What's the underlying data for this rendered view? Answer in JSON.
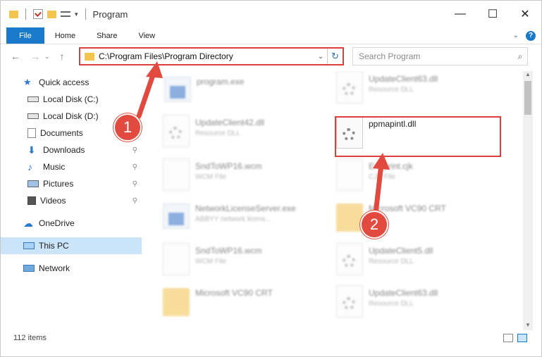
{
  "window": {
    "title": "Program",
    "controls": {
      "minimize": "—",
      "maximize": "☐",
      "close": "✕"
    }
  },
  "ribbon": {
    "tabs": [
      "File",
      "Home",
      "Share",
      "View"
    ],
    "expand_icon": "chevron-down",
    "help_label": "?"
  },
  "address": {
    "path": "C:\\Program Files\\Program Directory",
    "dropdown": "⌄",
    "refresh": "↻"
  },
  "search": {
    "placeholder": "Search Program",
    "icon": "⌕"
  },
  "sidebar": {
    "items": [
      {
        "label": "Quick access",
        "icon": "star-icon"
      },
      {
        "label": "Local Disk (C:)",
        "icon": "drive-icon"
      },
      {
        "label": "Local Disk (D:)",
        "icon": "drive-icon"
      },
      {
        "label": "Documents",
        "icon": "documents-icon"
      },
      {
        "label": "Downloads",
        "icon": "download-icon"
      },
      {
        "label": "Music",
        "icon": "music-icon"
      },
      {
        "label": "Pictures",
        "icon": "pictures-icon"
      },
      {
        "label": "Videos",
        "icon": "videos-icon"
      },
      {
        "label": "OneDrive",
        "icon": "cloud-icon"
      },
      {
        "label": "This PC",
        "icon": "computer-icon"
      },
      {
        "label": "Network",
        "icon": "network-icon"
      }
    ],
    "pin_glyph": "📌"
  },
  "files": [
    {
      "name": "program.exe",
      "type": ""
    },
    {
      "name": "UpdateClient63.dll",
      "type": "Resource DLL"
    },
    {
      "name": "UpdateClient42.dll",
      "type": "Resource DLL"
    },
    {
      "name": "ppmapintl.dll",
      "type": ""
    },
    {
      "name": "SndToWP16.wcm",
      "type": "WCM File"
    },
    {
      "name": "Endprint.cjk",
      "type": "CJK File"
    },
    {
      "name": "NetworkLicenseServer.exe",
      "type": "ABBYY network licens..."
    },
    {
      "name": "Microsoft VC90 CRT",
      "type": ""
    },
    {
      "name": "SndToWP16.wcm",
      "type": "WCM File"
    },
    {
      "name": "UpdateClient5.dll",
      "type": "Resource DLL"
    },
    {
      "name": "Microsoft VC90 CRT",
      "type": ""
    },
    {
      "name": "UpdateClient63.dll",
      "type": "Resource DLL"
    }
  ],
  "status": {
    "count": "112 items"
  },
  "annotations": {
    "step1": "1",
    "step2": "2"
  },
  "colors": {
    "accent": "#1979ca",
    "highlight": "#e23d3d",
    "badge": "#e24a3f"
  }
}
